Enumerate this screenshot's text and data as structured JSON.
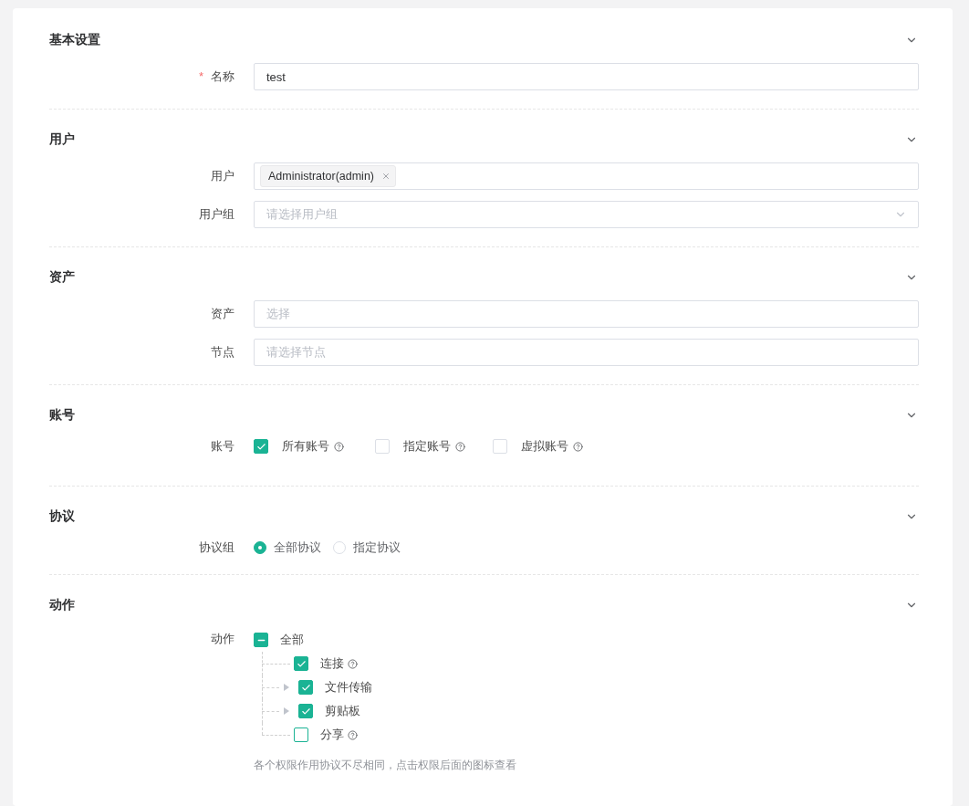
{
  "sections": [
    {
      "title": "基本设置",
      "expanded": true,
      "fields": [
        {
          "kind": "text",
          "label": "名称",
          "required_mark": "*",
          "value": "test"
        }
      ]
    },
    {
      "title": "用户",
      "expanded": true,
      "fields": [
        {
          "kind": "tags",
          "label": "用户",
          "tags": [
            "Administrator(admin)"
          ]
        },
        {
          "kind": "select",
          "label": "用户组",
          "placeholder": "请选择用户组"
        }
      ]
    },
    {
      "title": "资产",
      "expanded": true,
      "fields": [
        {
          "kind": "text",
          "label": "资产",
          "placeholder": "选择"
        },
        {
          "kind": "text",
          "label": "节点",
          "placeholder": "请选择节点"
        }
      ]
    },
    {
      "title": "账号",
      "expanded": true,
      "fields": [
        {
          "kind": "checkboxes",
          "label": "账号",
          "options": [
            {
              "label": "所有账号",
              "checked": true,
              "help": true
            },
            {
              "label": "指定账号",
              "checked": false,
              "help": true
            },
            {
              "label": "虚拟账号",
              "checked": false,
              "help": true
            }
          ]
        }
      ]
    },
    {
      "title": "协议",
      "expanded": true,
      "fields": [
        {
          "kind": "radios",
          "label": "协议组",
          "options": [
            {
              "label": "全部协议",
              "selected": true
            },
            {
              "label": "指定协议",
              "selected": false
            }
          ]
        }
      ]
    },
    {
      "title": "动作",
      "expanded": true,
      "fields": [
        {
          "kind": "tree",
          "label": "动作",
          "root": {
            "label": "全部",
            "indeterminate": true,
            "children": [
              {
                "label": "连接",
                "checked": true,
                "help": true,
                "expandable": false
              },
              {
                "label": "文件传输",
                "checked": true,
                "help": false,
                "expandable": true
              },
              {
                "label": "剪贴板",
                "checked": true,
                "help": false,
                "expandable": true
              },
              {
                "label": "分享",
                "checked": false,
                "help": true,
                "expandable": false
              }
            ]
          },
          "hint": "各个权限作用协议不尽相同，点击权限后面的图标查看"
        }
      ]
    }
  ]
}
